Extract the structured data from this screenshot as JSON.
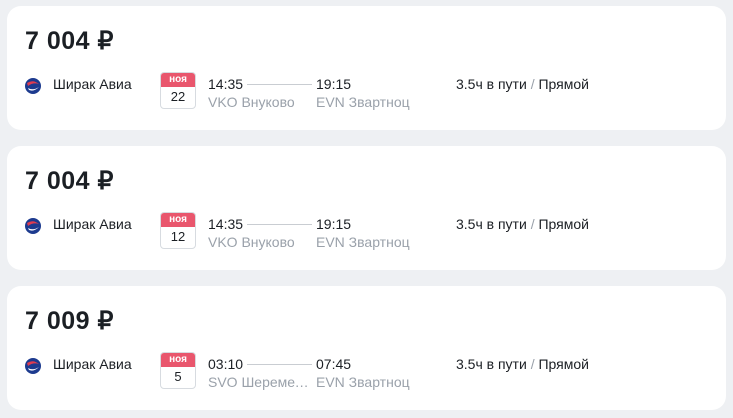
{
  "currency": "₽",
  "colors": {
    "badge_red": "#e9566d",
    "muted_text": "#9aa1aa",
    "logo_red": "#e03c4f",
    "logo_blue": "#1d3b8f"
  },
  "offers": [
    {
      "price": "7 004 ₽",
      "airline": "Ширак Авиа",
      "month": "ноя",
      "day": "22",
      "dep_time": "14:35",
      "arr_time": "19:15",
      "dep_airport": "VKO Внуково",
      "arr_airport": "EVN Звартноц",
      "duration": "3.5ч в пути",
      "separator": "/",
      "transfers": "Прямой"
    },
    {
      "price": "7 004 ₽",
      "airline": "Ширак Авиа",
      "month": "ноя",
      "day": "12",
      "dep_time": "14:35",
      "arr_time": "19:15",
      "dep_airport": "VKO Внуково",
      "arr_airport": "EVN Звартноц",
      "duration": "3.5ч в пути",
      "separator": "/",
      "transfers": "Прямой"
    },
    {
      "price": "7 009 ₽",
      "airline": "Ширак Авиа",
      "month": "ноя",
      "day": "5",
      "dep_time": "03:10",
      "arr_time": "07:45",
      "dep_airport": "SVO Шеремет...",
      "arr_airport": "EVN Звартноц",
      "duration": "3.5ч в пути",
      "separator": "/",
      "transfers": "Прямой"
    }
  ]
}
